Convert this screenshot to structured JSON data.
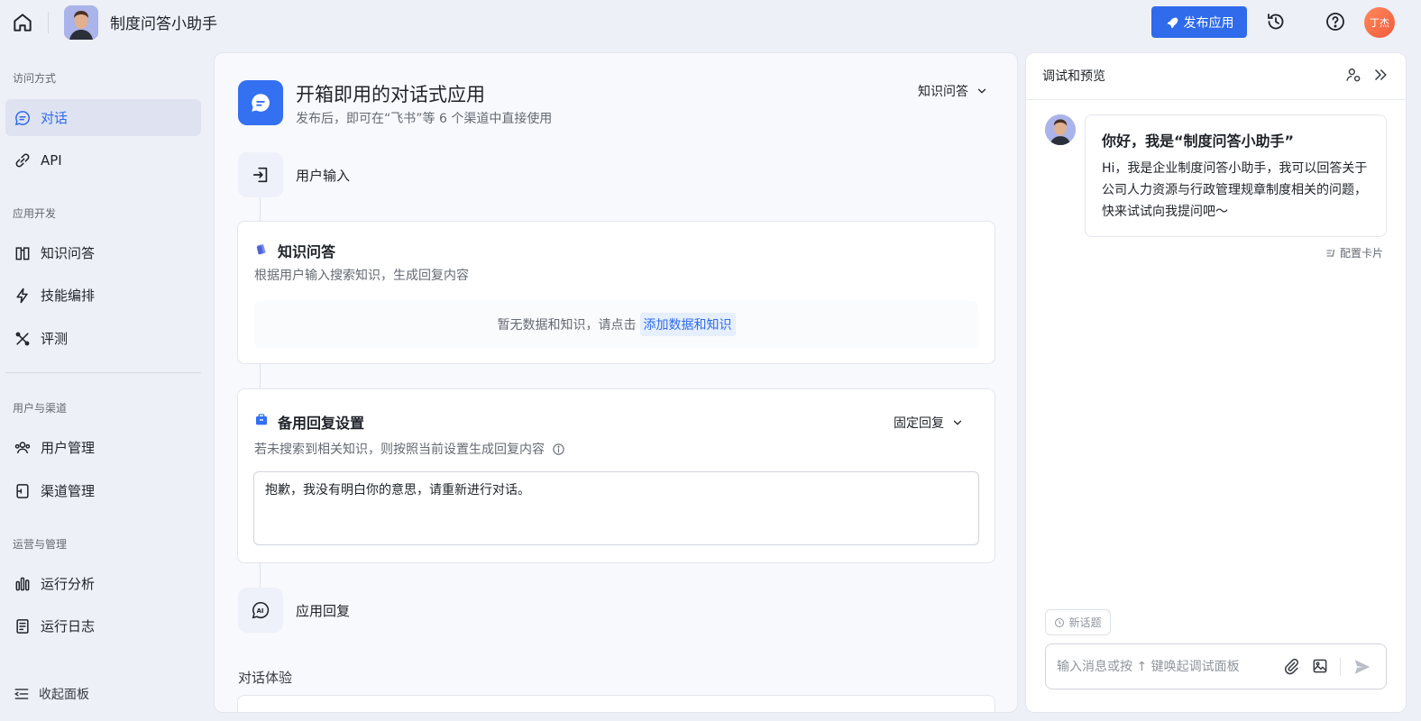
{
  "topbar": {
    "app_title": "制度问答小助手",
    "publish_label": "发布应用",
    "user_initials": "丁杰"
  },
  "sidebar": {
    "sections": {
      "access": "访问方式",
      "dev": "应用开发",
      "users": "用户与渠道",
      "ops": "运营与管理"
    },
    "items": [
      {
        "label": "对话",
        "icon": "chat-icon",
        "active": true
      },
      {
        "label": "API",
        "icon": "api-link-icon",
        "active": false
      },
      {
        "label": "知识问答",
        "icon": "book-icon",
        "active": false
      },
      {
        "label": "技能编排",
        "icon": "lightning-icon",
        "active": false
      },
      {
        "label": "评测",
        "icon": "tools-icon",
        "active": false
      },
      {
        "label": "用户管理",
        "icon": "users-icon",
        "active": false
      },
      {
        "label": "渠道管理",
        "icon": "channel-icon",
        "active": false
      },
      {
        "label": "运行分析",
        "icon": "bar-chart-icon",
        "active": false
      },
      {
        "label": "运行日志",
        "icon": "log-icon",
        "active": false
      }
    ],
    "collapse_label": "收起面板"
  },
  "main": {
    "title": "开箱即用的对话式应用",
    "subtitle": "发布后，即可在“飞书”等 6 个渠道中直接使用",
    "mode_value": "知识问答",
    "user_input_label": "用户输入",
    "knowledge": {
      "title": "知识问答",
      "desc": "根据用户输入搜索知识，生成回复内容",
      "empty_text": "暂无数据和知识，请点击",
      "add_link": "添加数据和知识"
    },
    "fallback": {
      "title": "备用回复设置",
      "desc": "若未搜索到相关知识，则按照当前设置生成回复内容",
      "mode_value": "固定回复",
      "reply_text": "抱歉，我没有明白你的意思，请重新进行对话。"
    },
    "app_reply_label": "应用回复",
    "experience_label": "对话体验"
  },
  "preview": {
    "title": "调试和预览",
    "greeting_title": "你好，我是“制度问答小助手”",
    "greeting_body": "Hi，我是企业制度问答小助手，我可以回答关于公司人力资源与行政管理规章制度相关的问题，快来试试向我提问吧～",
    "config_card_label": "配置卡片",
    "new_topic_label": "新话题",
    "input_placeholder": "输入消息或按 ↑ 键唤起调试面板"
  },
  "colors": {
    "accent": "#2f6bea",
    "sidebar_active_bg": "#dfe3f1",
    "page_bg": "#eef0f7"
  }
}
